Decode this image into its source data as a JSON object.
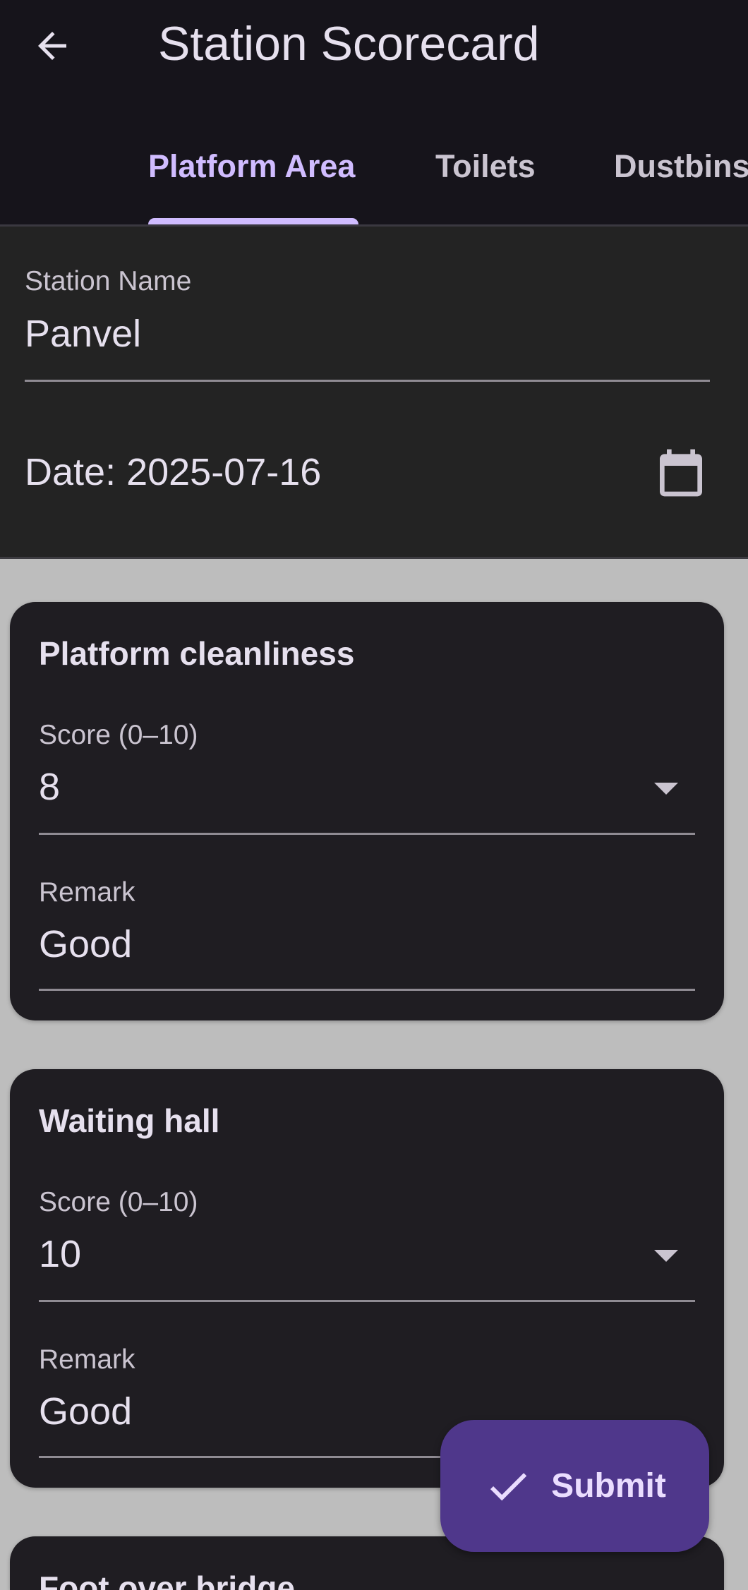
{
  "appbar": {
    "title": "Station Scorecard",
    "back_icon": "arrow-back-icon"
  },
  "tabs": [
    {
      "label": "Platform Area",
      "selected": true
    },
    {
      "label": "Toilets",
      "selected": false
    },
    {
      "label": "Dustbins",
      "selected": false
    }
  ],
  "form": {
    "station_label": "Station Name",
    "station_value": "Panvel",
    "date_text": "Date: 2025-07-16",
    "calendar_icon": "calendar-icon"
  },
  "cards": [
    {
      "title": "Platform cleanliness",
      "score_label": "Score (0–10)",
      "score_value": "8",
      "remark_label": "Remark",
      "remark_value": "Good"
    },
    {
      "title": "Waiting hall",
      "score_label": "Score (0–10)",
      "score_value": "10",
      "remark_label": "Remark",
      "remark_value": "Good"
    },
    {
      "title": "Foot over bridge"
    }
  ],
  "fab": {
    "label": "Submit",
    "icon": "check-icon"
  },
  "colors": {
    "background": "#bdbdbd",
    "appbar": "#16141b",
    "card": "#1f1d22",
    "accent": "#d0bcff",
    "fab": "#4f378b"
  }
}
